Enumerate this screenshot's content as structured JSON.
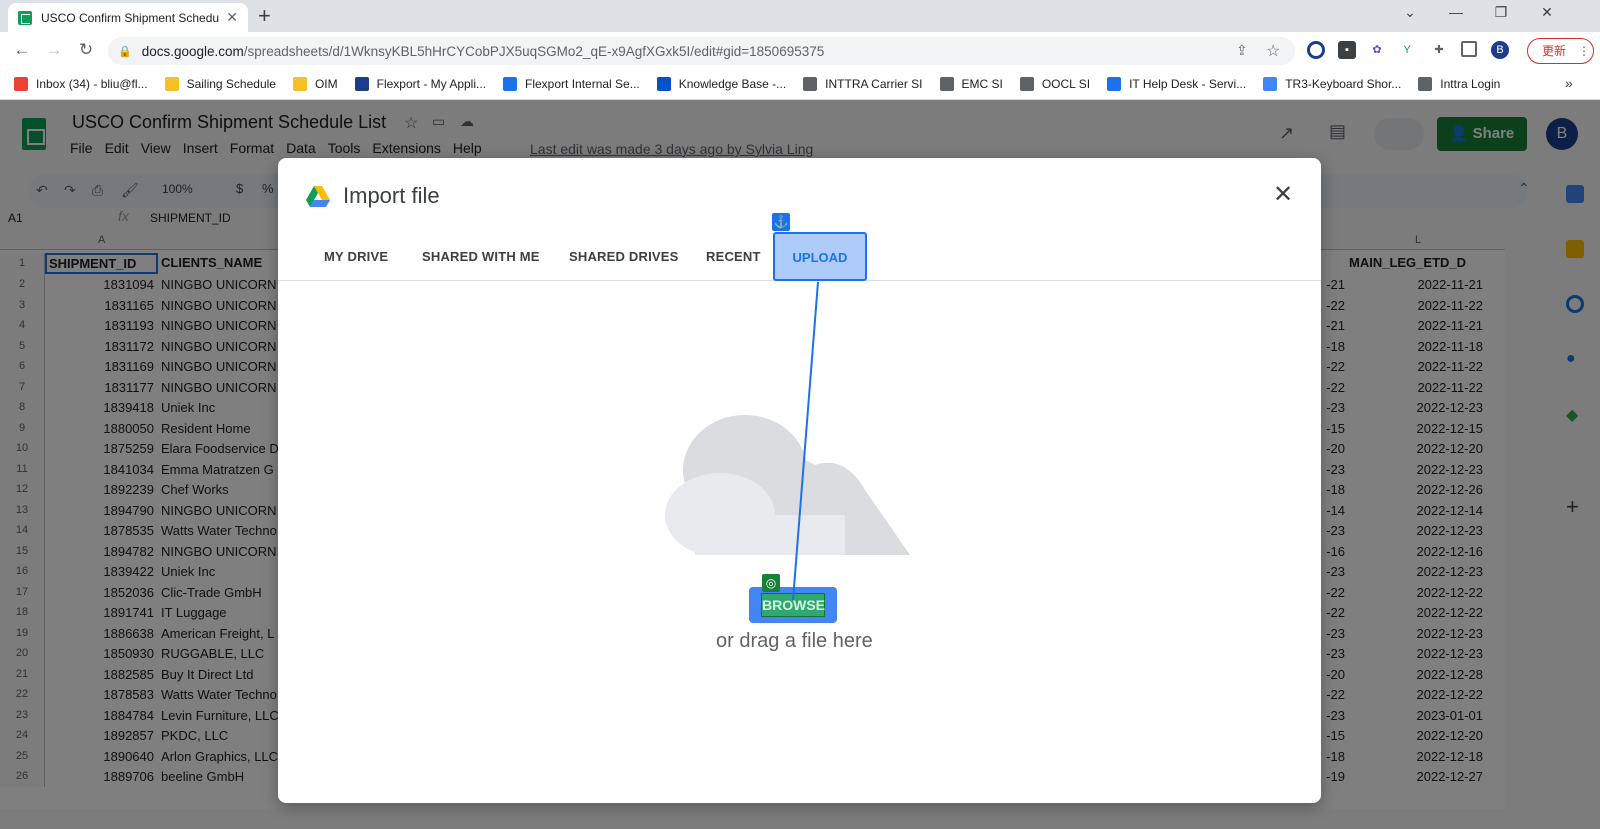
{
  "browser": {
    "tab_title": "USCO Confirm Shipment Schedu",
    "url_host": "docs.google.com",
    "url_path": "/spreadsheets/d/1WknsyKBL5hHrCYCobPJX5uqSGMo2_qE-x9AgfXGxk5I/edit#gid=1850695375",
    "update_label": "更新",
    "profile_initial": "B"
  },
  "bookmarks": [
    {
      "label": "Inbox (34) - bliu@fl...",
      "icon": "gmail-icon",
      "color": "#ea4335"
    },
    {
      "label": "Sailing Schedule",
      "icon": "folder-icon",
      "color": "#f6c026"
    },
    {
      "label": "OIM",
      "icon": "folder-icon",
      "color": "#f6c026"
    },
    {
      "label": "Flexport - My Appli...",
      "icon": "okta-icon",
      "color": "#1a3e8c"
    },
    {
      "label": "Flexport Internal Se...",
      "icon": "flexport-icon",
      "color": "#1a73e8"
    },
    {
      "label": "Knowledge Base -...",
      "icon": "atlassian-icon",
      "color": "#0052cc"
    },
    {
      "label": "INTTRA Carrier SI",
      "icon": "globe-icon",
      "color": "#5f6368"
    },
    {
      "label": "EMC SI",
      "icon": "globe-icon",
      "color": "#5f6368"
    },
    {
      "label": "OOCL SI",
      "icon": "globe-icon",
      "color": "#5f6368"
    },
    {
      "label": "IT Help Desk - Servi...",
      "icon": "flexport-icon",
      "color": "#1a73e8"
    },
    {
      "label": "TR3-Keyboard Shor...",
      "icon": "docs-icon",
      "color": "#4285f4"
    },
    {
      "label": "Inttra Login",
      "icon": "info-icon",
      "color": "#5f6368"
    }
  ],
  "sheets": {
    "doc_title": "USCO Confirm Shipment Schedule List",
    "menu": [
      "File",
      "Edit",
      "View",
      "Insert",
      "Format",
      "Data",
      "Tools",
      "Extensions",
      "Help"
    ],
    "last_edit": "Last edit was made 3 days ago by Sylvia Ling",
    "share_label": "Share",
    "zoom": "100%",
    "name_box": "A1",
    "formula": "SHIPMENT_ID",
    "col_a_header": "A",
    "col_l_header": "L",
    "headers": {
      "a": "SHIPMENT_ID",
      "b": "CLIENTS_NAME",
      "l": "MAIN_LEG_ETD_D"
    },
    "rows": [
      {
        "n": "2",
        "id": "1831094",
        "client": "NINGBO UNICORN",
        "k": "-21",
        "etd": "2022-11-21"
      },
      {
        "n": "3",
        "id": "1831165",
        "client": "NINGBO UNICORN",
        "k": "-22",
        "etd": "2022-11-22"
      },
      {
        "n": "4",
        "id": "1831193",
        "client": "NINGBO UNICORN",
        "k": "-21",
        "etd": "2022-11-21"
      },
      {
        "n": "5",
        "id": "1831172",
        "client": "NINGBO UNICORN",
        "k": "-18",
        "etd": "2022-11-18"
      },
      {
        "n": "6",
        "id": "1831169",
        "client": "NINGBO UNICORN",
        "k": "-22",
        "etd": "2022-11-22"
      },
      {
        "n": "7",
        "id": "1831177",
        "client": "NINGBO UNICORN",
        "k": "-22",
        "etd": "2022-11-22"
      },
      {
        "n": "8",
        "id": "1839418",
        "client": "Uniek Inc",
        "k": "-23",
        "etd": "2022-12-23"
      },
      {
        "n": "9",
        "id": "1880050",
        "client": "Resident Home",
        "k": "-15",
        "etd": "2022-12-15"
      },
      {
        "n": "10",
        "id": "1875259",
        "client": "Elara Foodservice D",
        "k": "-20",
        "etd": "2022-12-20"
      },
      {
        "n": "11",
        "id": "1841034",
        "client": "Emma Matratzen G",
        "k": "-23",
        "etd": "2022-12-23"
      },
      {
        "n": "12",
        "id": "1892239",
        "client": "Chef Works",
        "k": "-18",
        "etd": "2022-12-26"
      },
      {
        "n": "13",
        "id": "1894790",
        "client": "NINGBO UNICORN",
        "k": "-14",
        "etd": "2022-12-14"
      },
      {
        "n": "14",
        "id": "1878535",
        "client": "Watts Water Techno",
        "k": "-23",
        "etd": "2022-12-23"
      },
      {
        "n": "15",
        "id": "1894782",
        "client": "NINGBO UNICORN",
        "k": "-16",
        "etd": "2022-12-16"
      },
      {
        "n": "16",
        "id": "1839422",
        "client": "Uniek Inc",
        "k": "-23",
        "etd": "2022-12-23"
      },
      {
        "n": "17",
        "id": "1852036",
        "client": "Clic-Trade GmbH",
        "k": "-22",
        "etd": "2022-12-22"
      },
      {
        "n": "18",
        "id": "1891741",
        "client": "IT Luggage",
        "k": "-22",
        "etd": "2022-12-22"
      },
      {
        "n": "19",
        "id": "1886638",
        "client": "American Freight, L",
        "k": "-23",
        "etd": "2022-12-23"
      },
      {
        "n": "20",
        "id": "1850930",
        "client": "RUGGABLE, LLC",
        "k": "-23",
        "etd": "2022-12-23"
      },
      {
        "n": "21",
        "id": "1882585",
        "client": "Buy It Direct Ltd",
        "k": "-20",
        "etd": "2022-12-28"
      },
      {
        "n": "22",
        "id": "1878583",
        "client": "Watts Water Techno",
        "k": "-22",
        "etd": "2022-12-22"
      },
      {
        "n": "23",
        "id": "1884784",
        "client": "Levin Furniture, LLC",
        "k": "-23",
        "etd": "2023-01-01"
      },
      {
        "n": "24",
        "id": "1892857",
        "client": "PKDC, LLC",
        "k": "-15",
        "etd": "2022-12-20"
      },
      {
        "n": "25",
        "id": "1890640",
        "client": "Arlon Graphics, LLC",
        "k": "-18",
        "etd": "2022-12-18"
      },
      {
        "n": "26",
        "id": "1889706",
        "client": "beeline GmbH",
        "k": "-19",
        "etd": "2022-12-27"
      }
    ]
  },
  "dialog": {
    "title": "Import file",
    "tabs": [
      "MY DRIVE",
      "SHARED WITH ME",
      "SHARED DRIVES",
      "RECENT",
      "UPLOAD"
    ],
    "browse_label": "BROWSE",
    "drag_text": "or drag a file here",
    "close_icon": "close-icon"
  },
  "colors": {
    "accent": "#1a73e8",
    "sheets_green": "#0f9d58",
    "share_green": "#188038",
    "browse_blue": "#4285f4"
  }
}
